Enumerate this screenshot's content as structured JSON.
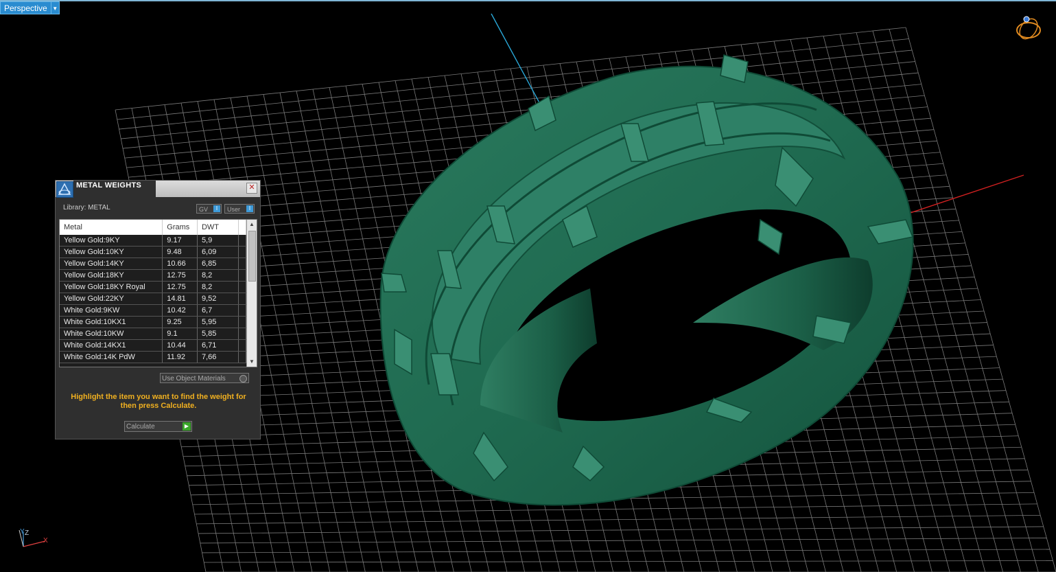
{
  "viewport": {
    "view_label": "Perspective",
    "axis_labels": {
      "z": "Z",
      "x": "X",
      "y": "Y"
    }
  },
  "panel": {
    "title": "METAL WEIGHTS",
    "library_label": "Library: METAL",
    "toggle_gv": "GV",
    "toggle_user": "User",
    "columns": [
      "Metal",
      "Grams",
      "DWT"
    ],
    "rows": [
      [
        "Yellow Gold:9KY",
        "9.17",
        "5,9"
      ],
      [
        "Yellow Gold:10KY",
        "9.48",
        "6,09"
      ],
      [
        "Yellow Gold:14KY",
        "10.66",
        "6,85"
      ],
      [
        "Yellow Gold:18KY",
        "12.75",
        "8,2"
      ],
      [
        "Yellow Gold:18KY Royal",
        "12.75",
        "8,2"
      ],
      [
        "Yellow Gold:22KY",
        "14.81",
        "9,52"
      ],
      [
        "White Gold:9KW",
        "10.42",
        "6,7"
      ],
      [
        "White Gold:10KX1",
        "9.25",
        "5,95"
      ],
      [
        "White Gold:10KW",
        "9.1",
        "5,85"
      ],
      [
        "White Gold:14KX1",
        "10.44",
        "6,71"
      ],
      [
        "White Gold:14K PdW",
        "11.92",
        "7,66"
      ]
    ],
    "use_object_materials": "Use Object Materials",
    "instruction": "Highlight the item you want to find the weight for then press Calculate.",
    "calculate": "Calculate"
  },
  "colors": {
    "ring": "#1f6a50",
    "grid": "#7a7a7a",
    "accent": "#2a8cd0",
    "instruction": "#f0b020"
  }
}
